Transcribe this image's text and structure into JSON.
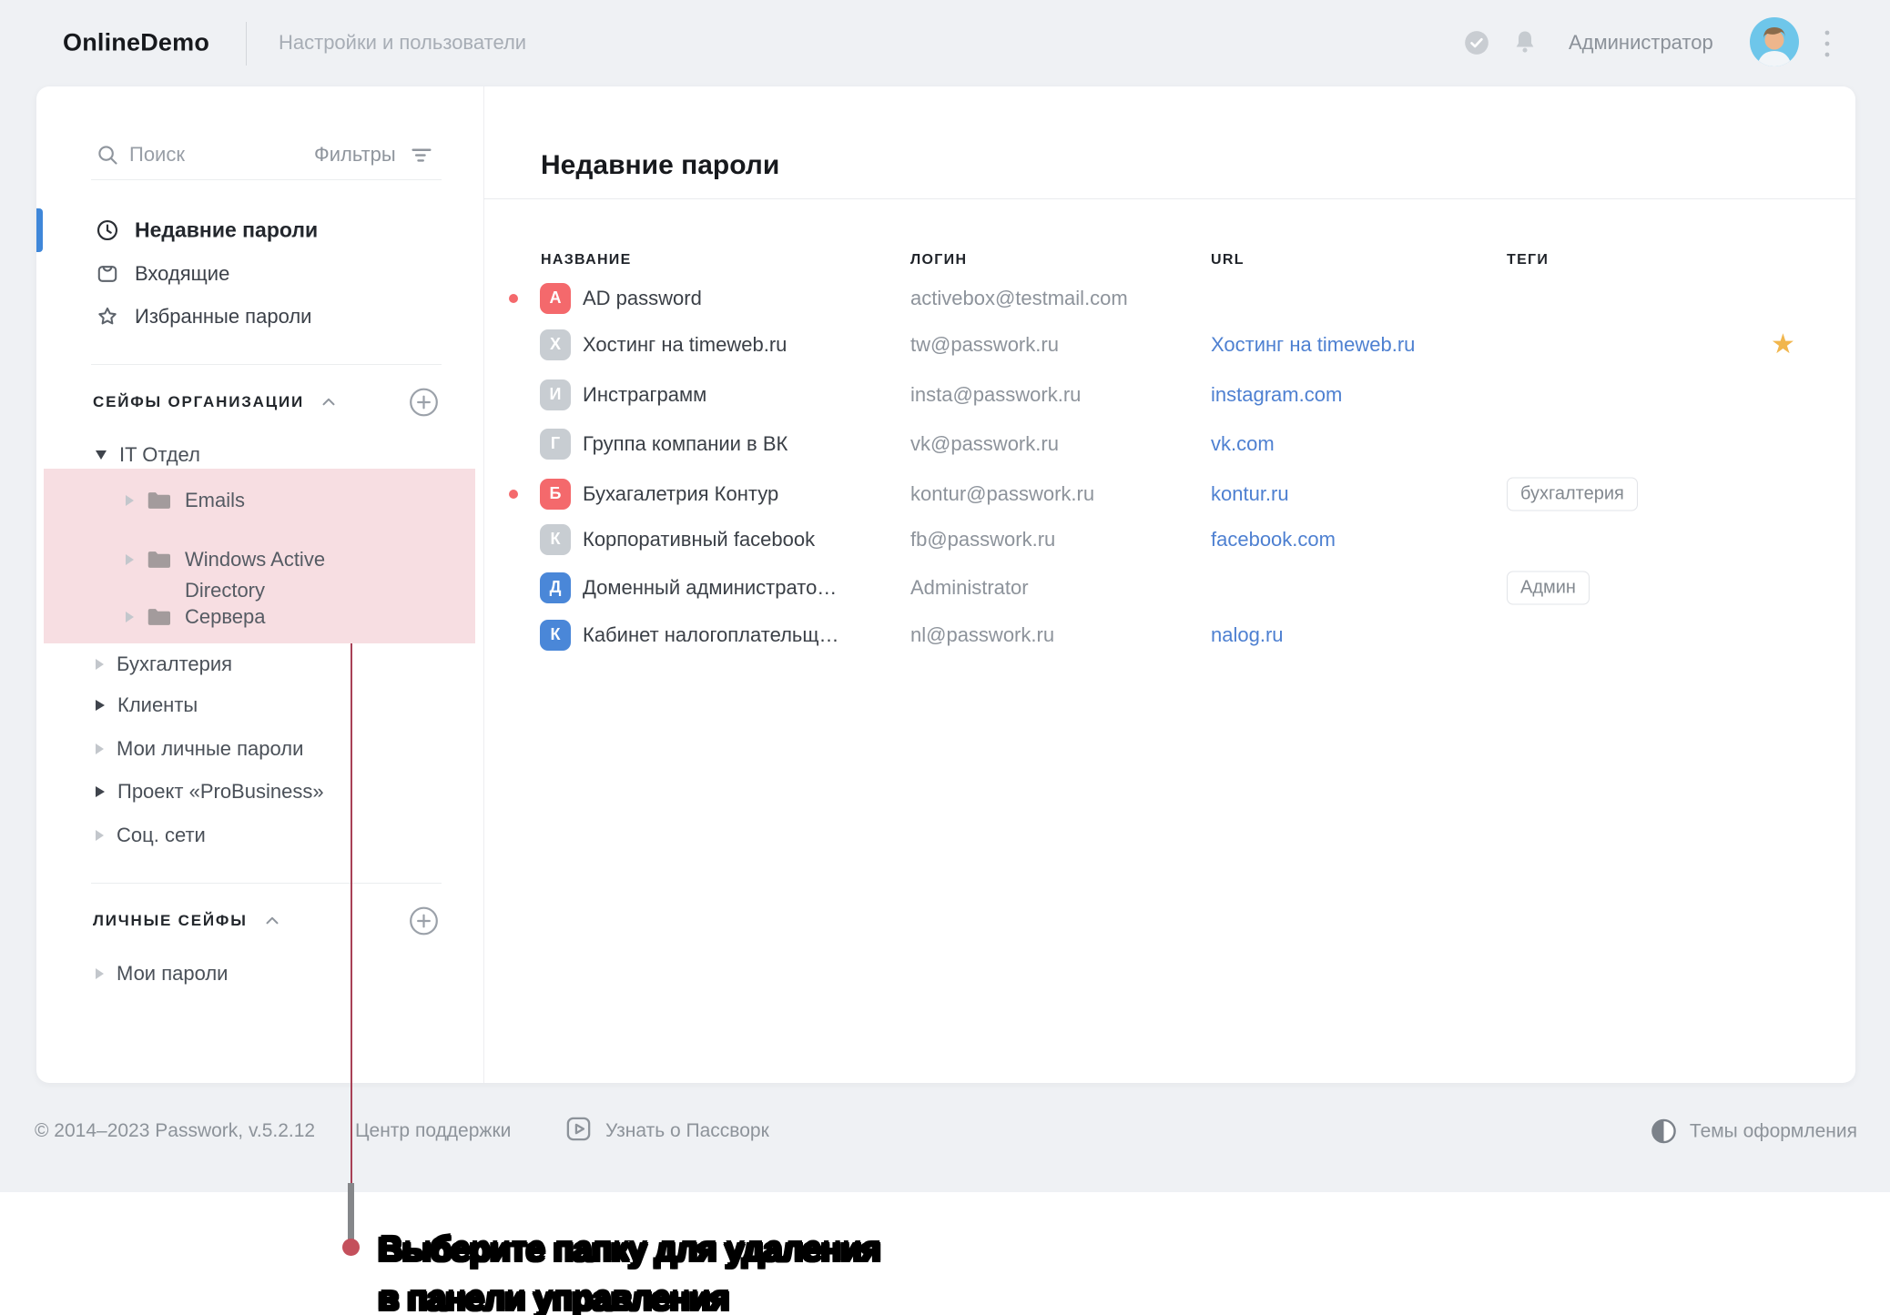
{
  "topbar": {
    "brand": "OnlineDemo",
    "section_title": "Настройки и пользователи",
    "user_name": "Администратор"
  },
  "sidebar": {
    "search_placeholder": "Поиск",
    "filters_label": "Фильтры",
    "nav": [
      {
        "label": "Недавние пароли",
        "active": true
      },
      {
        "label": "Входящие",
        "active": false
      },
      {
        "label": "Избранные пароли",
        "active": false
      }
    ],
    "org_section_title": "СЕЙФЫ ОРГАНИЗАЦИИ",
    "personal_section_title": "ЛИЧНЫЕ СЕЙФЫ",
    "tree": {
      "root": "IT Отдел",
      "children": [
        "Emails",
        "Windows Active Directory",
        "Сервера"
      ],
      "vaults": [
        "Бухгалтерия",
        "Клиенты",
        "Мои личные пароли",
        "Проект «ProBusiness»",
        "Соц. сети"
      ],
      "personal": [
        "Мои пароли"
      ]
    }
  },
  "main": {
    "title": "Недавние пароли",
    "columns": [
      "НАЗВАНИЕ",
      "ЛОГИН",
      "URL",
      "ТЕГИ"
    ],
    "rows": [
      {
        "badge": "А",
        "badge_color": "red",
        "dot": "red",
        "name": "AD password",
        "login": "activebox@testmail.com",
        "url": "",
        "tags": [],
        "starred": false
      },
      {
        "badge": "Х",
        "badge_color": "gray",
        "dot": "",
        "name": "Хостинг на timeweb.ru",
        "login": "tw@passwork.ru",
        "url": "Хостинг на timeweb.ru",
        "tags": [],
        "starred": true
      },
      {
        "badge": "И",
        "badge_color": "gray",
        "dot": "",
        "name": "Инстраграмм",
        "login": "insta@passwork.ru",
        "url": "instagram.com",
        "tags": [],
        "starred": false
      },
      {
        "badge": "Г",
        "badge_color": "gray",
        "dot": "",
        "name": "Группа компании в ВК",
        "login": "vk@passwork.ru",
        "url": "vk.com",
        "tags": [],
        "starred": false
      },
      {
        "badge": "Б",
        "badge_color": "red",
        "dot": "red",
        "name": "Бухагалетрия Контур",
        "login": "kontur@passwork.ru",
        "url": "kontur.ru",
        "tags": [
          "бухгалтерия"
        ],
        "starred": false
      },
      {
        "badge": "К",
        "badge_color": "gray",
        "dot": "",
        "name": "Корпоративный facebook",
        "login": "fb@passwork.ru",
        "url": "facebook.com",
        "tags": [],
        "starred": false
      },
      {
        "badge": "Д",
        "badge_color": "blue",
        "dot": "blue",
        "name": "Доменный администрато…",
        "login": "Administrator",
        "url": "",
        "tags": [
          "Админ"
        ],
        "starred": false
      },
      {
        "badge": "К",
        "badge_color": "blue",
        "dot": "blue",
        "name": "Кабинет налогоплательщ…",
        "login": "nl@passwork.ru",
        "url": "nalog.ru",
        "tags": [],
        "starred": false
      }
    ]
  },
  "footer": {
    "copyright": "© 2014–2023 Passwork, v.5.2.12",
    "support_label": "Центр поддержки",
    "learn_label": "Узнать о Пассворк",
    "themes_label": "Темы оформления"
  },
  "annotation": {
    "line1": "Выберите папку для удаления",
    "line2": "в панели управления"
  },
  "colors": {
    "accent_blue": "#3f87d9",
    "badge_red": "#f4696c",
    "badge_blue": "#4a87d8",
    "badge_gray": "#c8cdd2",
    "link_blue": "#4e80d1",
    "highlight_pink": "#f7dee2",
    "annotation_line": "#a84156",
    "star_yellow": "#f1b64d"
  }
}
